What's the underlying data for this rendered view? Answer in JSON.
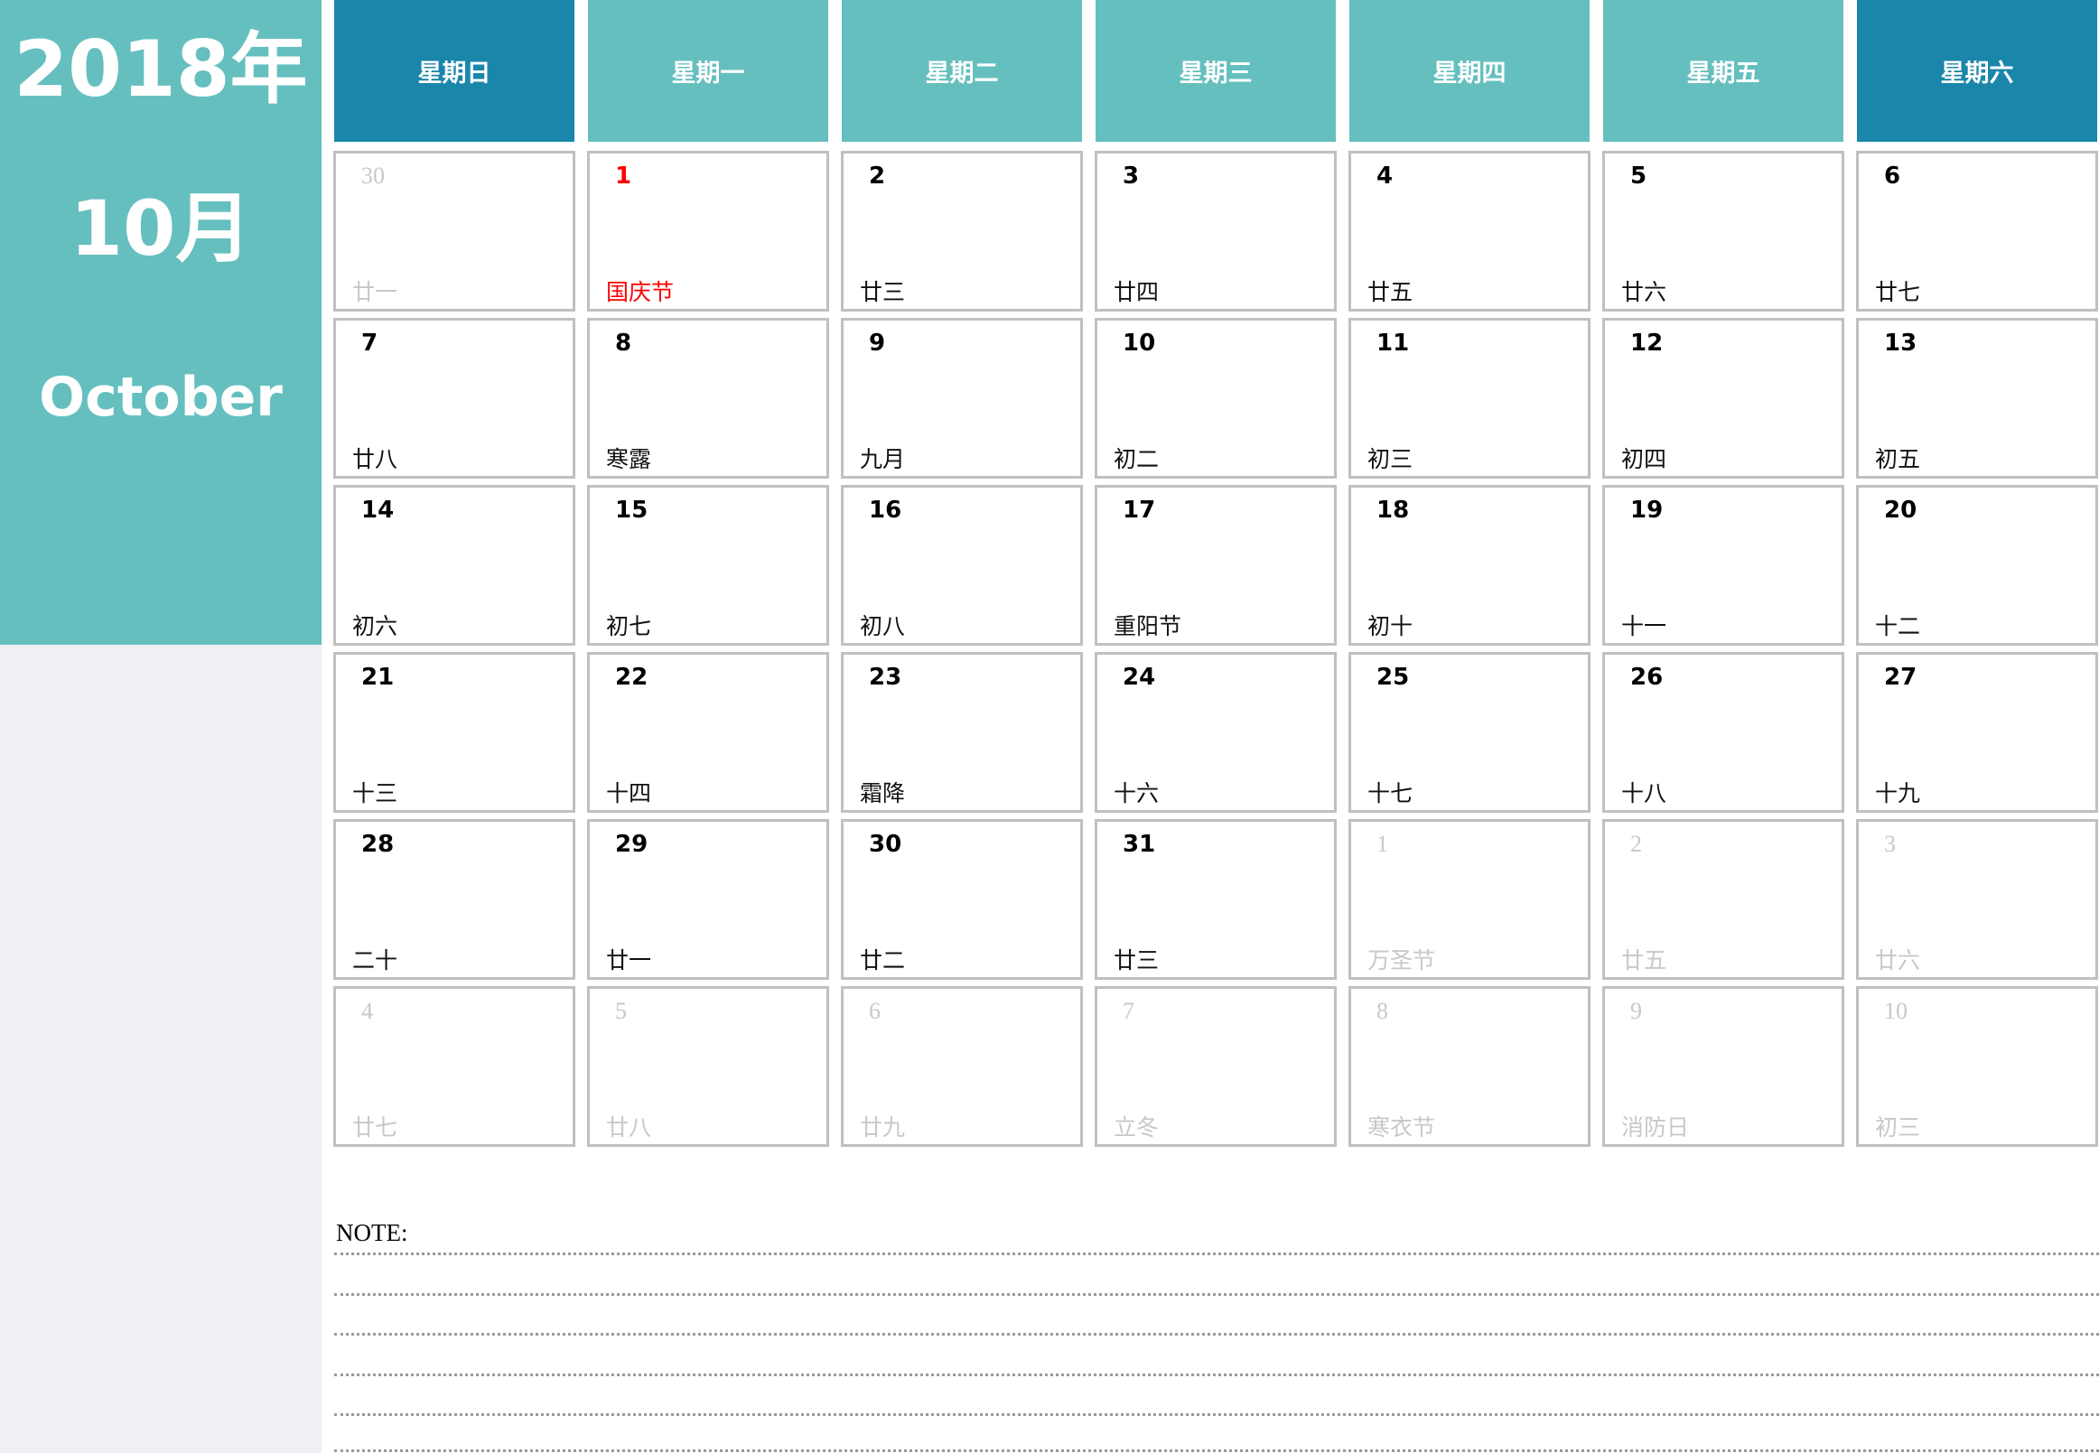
{
  "sidebar": {
    "year": "2018年",
    "month": "10月",
    "month_en": "October"
  },
  "colors": {
    "teal": "#66bfbf",
    "weekend_blue": "#1a86aa",
    "holiday_red": "#ff0000",
    "other_month_grey": "#c8c8c8"
  },
  "weekdays": [
    "星期日",
    "星期一",
    "星期二",
    "星期三",
    "星期四",
    "星期五",
    "星期六"
  ],
  "weeks": [
    [
      {
        "day": "30",
        "lunar": "廿一",
        "type": "other"
      },
      {
        "day": "1",
        "lunar": "国庆节",
        "type": "holiday"
      },
      {
        "day": "2",
        "lunar": "廿三",
        "type": "current"
      },
      {
        "day": "3",
        "lunar": "廿四",
        "type": "current"
      },
      {
        "day": "4",
        "lunar": "廿五",
        "type": "current"
      },
      {
        "day": "5",
        "lunar": "廿六",
        "type": "current"
      },
      {
        "day": "6",
        "lunar": "廿七",
        "type": "current"
      }
    ],
    [
      {
        "day": "7",
        "lunar": "廿八",
        "type": "current"
      },
      {
        "day": "8",
        "lunar": "寒露",
        "type": "current"
      },
      {
        "day": "9",
        "lunar": "九月",
        "type": "current"
      },
      {
        "day": "10",
        "lunar": "初二",
        "type": "current"
      },
      {
        "day": "11",
        "lunar": "初三",
        "type": "current"
      },
      {
        "day": "12",
        "lunar": "初四",
        "type": "current"
      },
      {
        "day": "13",
        "lunar": "初五",
        "type": "current"
      }
    ],
    [
      {
        "day": "14",
        "lunar": "初六",
        "type": "current"
      },
      {
        "day": "15",
        "lunar": "初七",
        "type": "current"
      },
      {
        "day": "16",
        "lunar": "初八",
        "type": "current"
      },
      {
        "day": "17",
        "lunar": "重阳节",
        "type": "current"
      },
      {
        "day": "18",
        "lunar": "初十",
        "type": "current"
      },
      {
        "day": "19",
        "lunar": "十一",
        "type": "current"
      },
      {
        "day": "20",
        "lunar": "十二",
        "type": "current"
      }
    ],
    [
      {
        "day": "21",
        "lunar": "十三",
        "type": "current"
      },
      {
        "day": "22",
        "lunar": "十四",
        "type": "current"
      },
      {
        "day": "23",
        "lunar": "霜降",
        "type": "current"
      },
      {
        "day": "24",
        "lunar": "十六",
        "type": "current"
      },
      {
        "day": "25",
        "lunar": "十七",
        "type": "current"
      },
      {
        "day": "26",
        "lunar": "十八",
        "type": "current"
      },
      {
        "day": "27",
        "lunar": "十九",
        "type": "current"
      }
    ],
    [
      {
        "day": "28",
        "lunar": "二十",
        "type": "current"
      },
      {
        "day": "29",
        "lunar": "廿一",
        "type": "current"
      },
      {
        "day": "30",
        "lunar": "廿二",
        "type": "current"
      },
      {
        "day": "31",
        "lunar": "廿三",
        "type": "current"
      },
      {
        "day": "1",
        "lunar": "万圣节",
        "type": "other"
      },
      {
        "day": "2",
        "lunar": "廿五",
        "type": "other"
      },
      {
        "day": "3",
        "lunar": "廿六",
        "type": "other"
      }
    ],
    [
      {
        "day": "4",
        "lunar": "廿七",
        "type": "other"
      },
      {
        "day": "5",
        "lunar": "廿八",
        "type": "other"
      },
      {
        "day": "6",
        "lunar": "廿九",
        "type": "other"
      },
      {
        "day": "7",
        "lunar": "立冬",
        "type": "other"
      },
      {
        "day": "8",
        "lunar": "寒衣节",
        "type": "other"
      },
      {
        "day": "9",
        "lunar": "消防日",
        "type": "other"
      },
      {
        "day": "10",
        "lunar": "初三",
        "type": "other"
      }
    ]
  ],
  "notes": {
    "label": "NOTE:",
    "line_count": 6
  }
}
